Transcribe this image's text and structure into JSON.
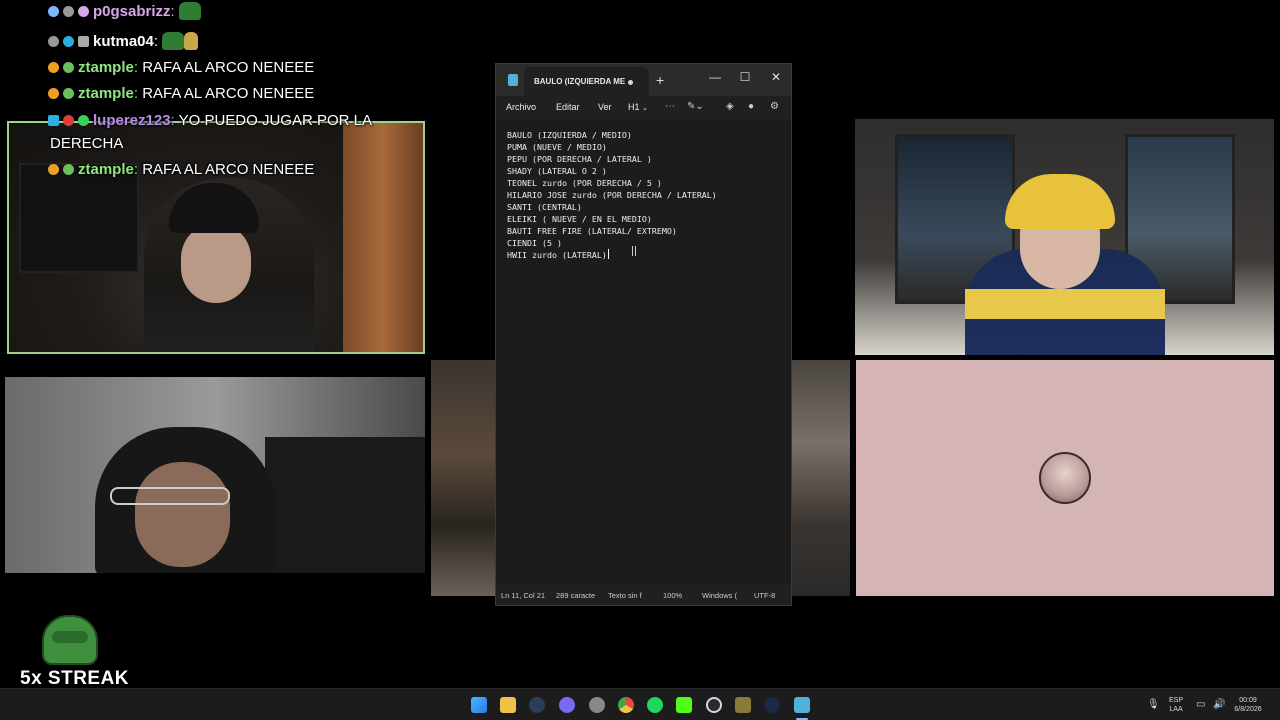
{
  "chat": {
    "messages": [
      {
        "user": "p0gsabrizz",
        "text": "",
        "color": "#d8a6e8"
      },
      {
        "user": "kutma04",
        "text": "",
        "color": "#f0f0f0"
      },
      {
        "user": "ztample",
        "text": "RAFA AL ARCO NENEEE",
        "color": "#8be87c"
      },
      {
        "user": "ztample",
        "text": "RAFA AL ARCO NENEEE",
        "color": "#8be87c"
      },
      {
        "user": "luperez123",
        "text": "YO PUEDO JUGAR POR LA",
        "color": "#b58be8"
      },
      {
        "user": "",
        "text": "DERECHA",
        "color": "#ffffff"
      },
      {
        "user": "ztample",
        "text": "RAFA AL ARCO NENEEE",
        "color": "#8be87c"
      }
    ],
    "streak_label": "5x STREAK"
  },
  "notepad": {
    "tab_title": "BAULO (IZQUIERDA  ME",
    "menu": {
      "file": "Archivo",
      "edit": "Editar",
      "view": "Ver",
      "heading": "H1"
    },
    "lines": [
      "BAULO (IZQUIERDA / MEDIO)",
      "PUMA (NUEVE / MEDIO)",
      "PEPU (POR DERECHA / LATERAL )",
      "SHADY (LATERAL O 2 )",
      "TEONEL zurdo (POR DERECHA / 5 )",
      "HILARIO JOSE zurdo (POR DERECHA / LATERAL)",
      "SANTI (CENTRAL)",
      "ELEIKI ( NUEVE / EN EL MEDIO)",
      "BAUTI FREE FIRE (LATERAL/ EXTREMO)",
      "CIENDI (5 )",
      "HWII zurdo (LATERAL)"
    ],
    "status": {
      "position": "Ln 11, Col 21",
      "chars": "289 caracte",
      "format": "Texto sin f",
      "zoom": "100%",
      "line_ending": "Windows (",
      "encoding": "UTF-8"
    }
  },
  "taskbar": {
    "lang_top": "ESP",
    "lang_bottom": "LAA",
    "time": "00:09",
    "date": "6/8/2026"
  }
}
